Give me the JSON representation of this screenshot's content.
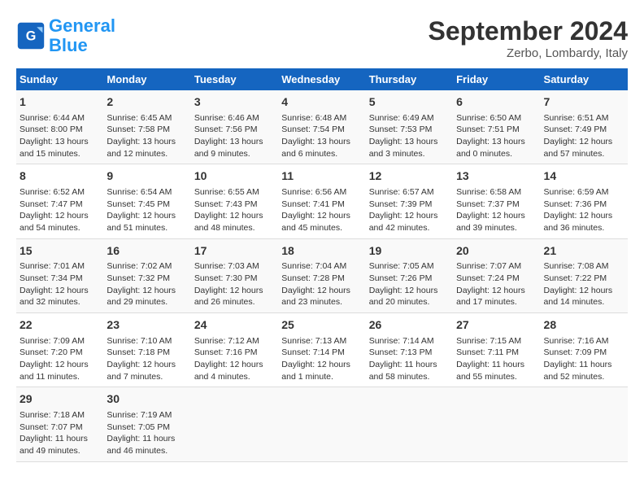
{
  "header": {
    "logo_line1": "General",
    "logo_line2": "Blue",
    "month": "September 2024",
    "location": "Zerbo, Lombardy, Italy"
  },
  "days_of_week": [
    "Sunday",
    "Monday",
    "Tuesday",
    "Wednesday",
    "Thursday",
    "Friday",
    "Saturday"
  ],
  "weeks": [
    [
      {
        "day": "1",
        "data": "Sunrise: 6:44 AM\nSunset: 8:00 PM\nDaylight: 13 hours\nand 15 minutes."
      },
      {
        "day": "2",
        "data": "Sunrise: 6:45 AM\nSunset: 7:58 PM\nDaylight: 13 hours\nand 12 minutes."
      },
      {
        "day": "3",
        "data": "Sunrise: 6:46 AM\nSunset: 7:56 PM\nDaylight: 13 hours\nand 9 minutes."
      },
      {
        "day": "4",
        "data": "Sunrise: 6:48 AM\nSunset: 7:54 PM\nDaylight: 13 hours\nand 6 minutes."
      },
      {
        "day": "5",
        "data": "Sunrise: 6:49 AM\nSunset: 7:53 PM\nDaylight: 13 hours\nand 3 minutes."
      },
      {
        "day": "6",
        "data": "Sunrise: 6:50 AM\nSunset: 7:51 PM\nDaylight: 13 hours\nand 0 minutes."
      },
      {
        "day": "7",
        "data": "Sunrise: 6:51 AM\nSunset: 7:49 PM\nDaylight: 12 hours\nand 57 minutes."
      }
    ],
    [
      {
        "day": "8",
        "data": "Sunrise: 6:52 AM\nSunset: 7:47 PM\nDaylight: 12 hours\nand 54 minutes."
      },
      {
        "day": "9",
        "data": "Sunrise: 6:54 AM\nSunset: 7:45 PM\nDaylight: 12 hours\nand 51 minutes."
      },
      {
        "day": "10",
        "data": "Sunrise: 6:55 AM\nSunset: 7:43 PM\nDaylight: 12 hours\nand 48 minutes."
      },
      {
        "day": "11",
        "data": "Sunrise: 6:56 AM\nSunset: 7:41 PM\nDaylight: 12 hours\nand 45 minutes."
      },
      {
        "day": "12",
        "data": "Sunrise: 6:57 AM\nSunset: 7:39 PM\nDaylight: 12 hours\nand 42 minutes."
      },
      {
        "day": "13",
        "data": "Sunrise: 6:58 AM\nSunset: 7:37 PM\nDaylight: 12 hours\nand 39 minutes."
      },
      {
        "day": "14",
        "data": "Sunrise: 6:59 AM\nSunset: 7:36 PM\nDaylight: 12 hours\nand 36 minutes."
      }
    ],
    [
      {
        "day": "15",
        "data": "Sunrise: 7:01 AM\nSunset: 7:34 PM\nDaylight: 12 hours\nand 32 minutes."
      },
      {
        "day": "16",
        "data": "Sunrise: 7:02 AM\nSunset: 7:32 PM\nDaylight: 12 hours\nand 29 minutes."
      },
      {
        "day": "17",
        "data": "Sunrise: 7:03 AM\nSunset: 7:30 PM\nDaylight: 12 hours\nand 26 minutes."
      },
      {
        "day": "18",
        "data": "Sunrise: 7:04 AM\nSunset: 7:28 PM\nDaylight: 12 hours\nand 23 minutes."
      },
      {
        "day": "19",
        "data": "Sunrise: 7:05 AM\nSunset: 7:26 PM\nDaylight: 12 hours\nand 20 minutes."
      },
      {
        "day": "20",
        "data": "Sunrise: 7:07 AM\nSunset: 7:24 PM\nDaylight: 12 hours\nand 17 minutes."
      },
      {
        "day": "21",
        "data": "Sunrise: 7:08 AM\nSunset: 7:22 PM\nDaylight: 12 hours\nand 14 minutes."
      }
    ],
    [
      {
        "day": "22",
        "data": "Sunrise: 7:09 AM\nSunset: 7:20 PM\nDaylight: 12 hours\nand 11 minutes."
      },
      {
        "day": "23",
        "data": "Sunrise: 7:10 AM\nSunset: 7:18 PM\nDaylight: 12 hours\nand 7 minutes."
      },
      {
        "day": "24",
        "data": "Sunrise: 7:12 AM\nSunset: 7:16 PM\nDaylight: 12 hours\nand 4 minutes."
      },
      {
        "day": "25",
        "data": "Sunrise: 7:13 AM\nSunset: 7:14 PM\nDaylight: 12 hours\nand 1 minute."
      },
      {
        "day": "26",
        "data": "Sunrise: 7:14 AM\nSunset: 7:13 PM\nDaylight: 11 hours\nand 58 minutes."
      },
      {
        "day": "27",
        "data": "Sunrise: 7:15 AM\nSunset: 7:11 PM\nDaylight: 11 hours\nand 55 minutes."
      },
      {
        "day": "28",
        "data": "Sunrise: 7:16 AM\nSunset: 7:09 PM\nDaylight: 11 hours\nand 52 minutes."
      }
    ],
    [
      {
        "day": "29",
        "data": "Sunrise: 7:18 AM\nSunset: 7:07 PM\nDaylight: 11 hours\nand 49 minutes."
      },
      {
        "day": "30",
        "data": "Sunrise: 7:19 AM\nSunset: 7:05 PM\nDaylight: 11 hours\nand 46 minutes."
      },
      {
        "day": "",
        "data": ""
      },
      {
        "day": "",
        "data": ""
      },
      {
        "day": "",
        "data": ""
      },
      {
        "day": "",
        "data": ""
      },
      {
        "day": "",
        "data": ""
      }
    ]
  ]
}
